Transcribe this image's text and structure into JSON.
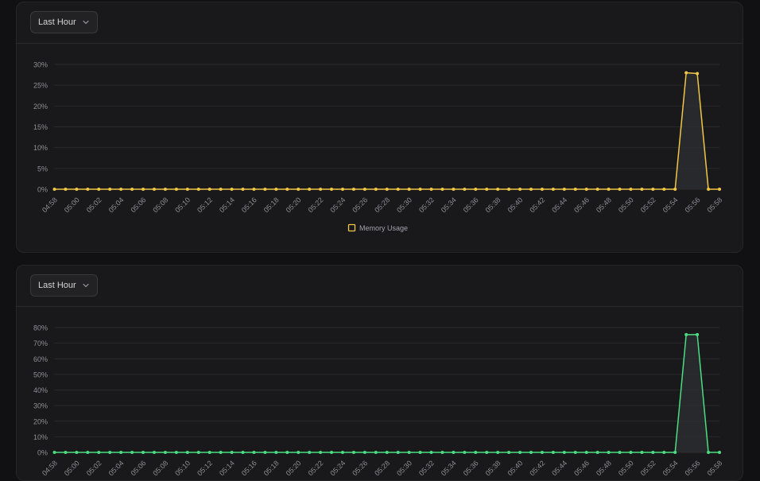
{
  "colors": {
    "memory": "#f0c646",
    "cpu": "#4ade80",
    "grid": "#2a2a2e",
    "tick": "#8e8e96"
  },
  "panels": [
    {
      "select_label": "Last Hour",
      "chevron_icon": "chevron-down-icon"
    },
    {
      "select_label": "Last Hour",
      "chevron_icon": "chevron-down-icon"
    }
  ],
  "chart_data": [
    {
      "type": "area",
      "title": "",
      "xlabel": "",
      "ylabel": "",
      "y_unit": "%",
      "ylim": [
        0,
        30
      ],
      "yticks": [
        0,
        5,
        10,
        15,
        20,
        25,
        30
      ],
      "xtick_labels": [
        "04:58",
        "05:00",
        "05:02",
        "05:04",
        "05:06",
        "05:08",
        "05:10",
        "05:12",
        "05:14",
        "05:16",
        "05:18",
        "05:20",
        "05:22",
        "05:24",
        "05:26",
        "05:28",
        "05:30",
        "05:32",
        "05:34",
        "05:36",
        "05:38",
        "05:40",
        "05:42",
        "05:44",
        "05:46",
        "05:48",
        "05:50",
        "05:52",
        "05:54",
        "05:56",
        "05:58"
      ],
      "x": [
        "04:58",
        "04:59",
        "05:00",
        "05:01",
        "05:02",
        "05:03",
        "05:04",
        "05:05",
        "05:06",
        "05:07",
        "05:08",
        "05:09",
        "05:10",
        "05:11",
        "05:12",
        "05:13",
        "05:14",
        "05:15",
        "05:16",
        "05:17",
        "05:18",
        "05:19",
        "05:20",
        "05:21",
        "05:22",
        "05:23",
        "05:24",
        "05:25",
        "05:26",
        "05:27",
        "05:28",
        "05:29",
        "05:30",
        "05:31",
        "05:32",
        "05:33",
        "05:34",
        "05:35",
        "05:36",
        "05:37",
        "05:38",
        "05:39",
        "05:40",
        "05:41",
        "05:42",
        "05:43",
        "05:44",
        "05:45",
        "05:46",
        "05:47",
        "05:48",
        "05:49",
        "05:50",
        "05:51",
        "05:52",
        "05:53",
        "05:54",
        "05:55",
        "05:56",
        "05:57",
        "05:58"
      ],
      "series": [
        {
          "name": "Memory Usage",
          "values": [
            0,
            0,
            0,
            0,
            0,
            0,
            0,
            0,
            0,
            0,
            0,
            0,
            0,
            0,
            0,
            0,
            0,
            0,
            0,
            0,
            0,
            0,
            0,
            0,
            0,
            0,
            0,
            0,
            0,
            0,
            0,
            0,
            0,
            0,
            0,
            0,
            0,
            0,
            0,
            0,
            0,
            0,
            0,
            0,
            0,
            0,
            0,
            0,
            0,
            0,
            0,
            0,
            0,
            0,
            0,
            0,
            0,
            28,
            27.8,
            0,
            0
          ]
        }
      ],
      "legend": "bottom-center",
      "grid": true
    },
    {
      "type": "area",
      "title": "",
      "xlabel": "",
      "ylabel": "",
      "y_unit": "%",
      "ylim": [
        0,
        80
      ],
      "yticks": [
        0,
        10,
        20,
        30,
        40,
        50,
        60,
        70,
        80
      ],
      "xtick_labels": [
        "04:58",
        "05:00",
        "05:02",
        "05:04",
        "05:06",
        "05:08",
        "05:10",
        "05:12",
        "05:14",
        "05:16",
        "05:18",
        "05:20",
        "05:22",
        "05:24",
        "05:26",
        "05:28",
        "05:30",
        "05:32",
        "05:34",
        "05:36",
        "05:38",
        "05:40",
        "05:42",
        "05:44",
        "05:46",
        "05:48",
        "05:50",
        "05:52",
        "05:54",
        "05:56",
        "05:58"
      ],
      "x": [
        "04:58",
        "04:59",
        "05:00",
        "05:01",
        "05:02",
        "05:03",
        "05:04",
        "05:05",
        "05:06",
        "05:07",
        "05:08",
        "05:09",
        "05:10",
        "05:11",
        "05:12",
        "05:13",
        "05:14",
        "05:15",
        "05:16",
        "05:17",
        "05:18",
        "05:19",
        "05:20",
        "05:21",
        "05:22",
        "05:23",
        "05:24",
        "05:25",
        "05:26",
        "05:27",
        "05:28",
        "05:29",
        "05:30",
        "05:31",
        "05:32",
        "05:33",
        "05:34",
        "05:35",
        "05:36",
        "05:37",
        "05:38",
        "05:39",
        "05:40",
        "05:41",
        "05:42",
        "05:43",
        "05:44",
        "05:45",
        "05:46",
        "05:47",
        "05:48",
        "05:49",
        "05:50",
        "05:51",
        "05:52",
        "05:53",
        "05:54",
        "05:55",
        "05:56",
        "05:57",
        "05:58"
      ],
      "series": [
        {
          "values": [
            0,
            0,
            0,
            0,
            0,
            0,
            0,
            0,
            0,
            0,
            0,
            0,
            0,
            0,
            0,
            0,
            0,
            0,
            0,
            0,
            0,
            0,
            0,
            0,
            0,
            0,
            0,
            0,
            0,
            0,
            0,
            0,
            0,
            0,
            0,
            0,
            0,
            0,
            0,
            0,
            0,
            0,
            0,
            0,
            0,
            0,
            0,
            0,
            0,
            0,
            0,
            0,
            0,
            0,
            0,
            0,
            0,
            75.5,
            75.5,
            0,
            0
          ]
        }
      ],
      "grid": true
    }
  ]
}
